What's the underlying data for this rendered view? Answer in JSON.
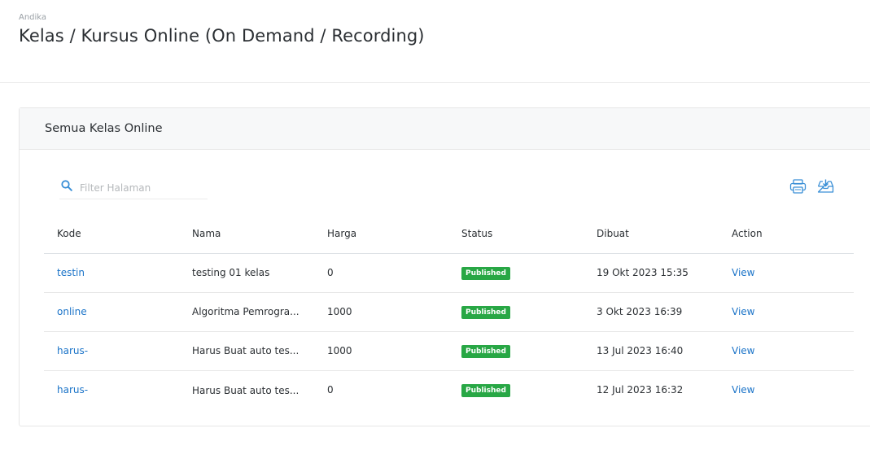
{
  "header": {
    "user": "Andika",
    "title": "Kelas / Kursus Online (On Demand / Recording)"
  },
  "card": {
    "title": "Semua Kelas Online",
    "search": {
      "placeholder": "Filter Halaman",
      "value": ""
    },
    "icons": {
      "search": "search-icon",
      "print": "print-icon",
      "download": "download-icon"
    }
  },
  "table": {
    "headers": [
      "Kode",
      "Nama",
      "Harga",
      "Status",
      "Dibuat",
      "Action"
    ],
    "rows": [
      {
        "kode": "testin",
        "nama": "testing 01 kelas",
        "harga": "0",
        "status": "Published",
        "dibuat": "19 Okt 2023 15:35",
        "action": "View"
      },
      {
        "kode": "online",
        "nama": "Algoritma Pemrogra...",
        "harga": "1000",
        "status": "Published",
        "dibuat": "3 Okt 2023 16:39",
        "action": "View"
      },
      {
        "kode": "harus-",
        "nama": "Harus Buat auto tes...",
        "harga": "1000",
        "status": "Published",
        "dibuat": "13 Jul 2023 16:40",
        "action": "View"
      },
      {
        "kode": "harus-",
        "nama": "Harus Buat auto tes...",
        "harga": "0",
        "status": "Published",
        "dibuat": "12 Jul 2023 16:32",
        "action": "View"
      }
    ]
  },
  "colors": {
    "accent": "#1a73c8",
    "badge": "#28a745",
    "icon": "#3a8fd6"
  }
}
